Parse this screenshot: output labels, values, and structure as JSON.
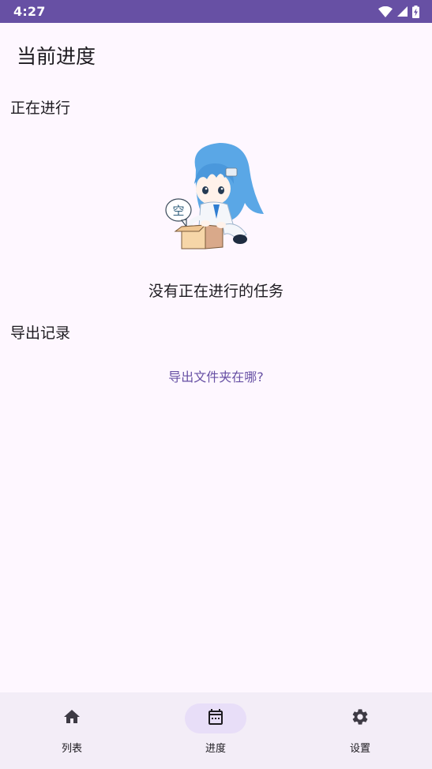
{
  "status_bar": {
    "time": "4:27",
    "icons": [
      "wifi-icon",
      "cellular-signal-icon",
      "battery-charging-icon"
    ]
  },
  "page": {
    "title": "当前进度"
  },
  "sections": {
    "running": {
      "heading": "正在进行",
      "empty_bubble_text": "空",
      "empty_message": "没有正在进行的任务"
    },
    "export": {
      "heading": "导出记录",
      "link_text": "导出文件夹在哪?"
    }
  },
  "bottom_nav": {
    "items": [
      {
        "label": "列表",
        "icon": "home-icon",
        "active": false
      },
      {
        "label": "进度",
        "icon": "calendar-icon",
        "active": true
      },
      {
        "label": "设置",
        "icon": "gear-icon",
        "active": false
      }
    ]
  },
  "colors": {
    "primary": "#6750a4",
    "background": "#fef7ff",
    "nav_background": "#f3edf7",
    "active_indicator": "#e8def8",
    "text": "#1d1b20"
  }
}
